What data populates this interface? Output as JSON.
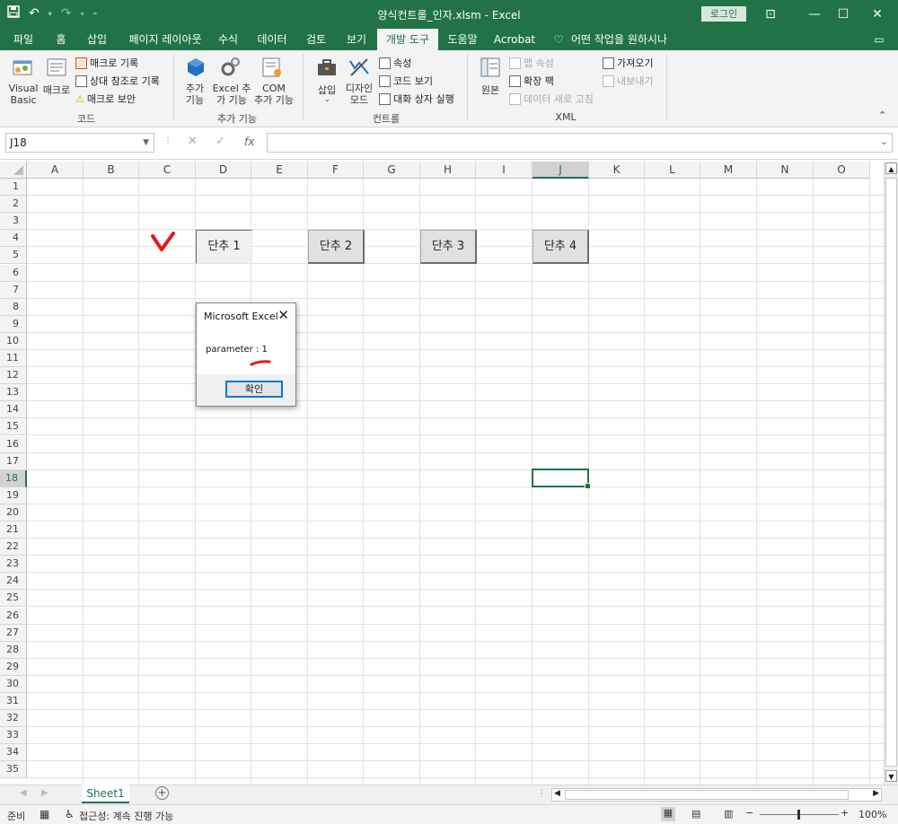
{
  "window": {
    "title": "양식컨트롤_인자.xlsm  -  Excel",
    "login_label": "로그인"
  },
  "tabs": [
    {
      "label": "파일"
    },
    {
      "label": "홈"
    },
    {
      "label": "삽입"
    },
    {
      "label": "페이지 레이아웃"
    },
    {
      "label": "수식"
    },
    {
      "label": "데이터"
    },
    {
      "label": "검토"
    },
    {
      "label": "보기"
    },
    {
      "label": "개발 도구"
    },
    {
      "label": "도움말"
    },
    {
      "label": "Acrobat"
    },
    {
      "label": "어떤 작업을 원하시나요?"
    }
  ],
  "ribbon": {
    "code": {
      "group_label": "코드",
      "visual_basic": [
        "Visual",
        "Basic"
      ],
      "macro": "매크로",
      "record_macro": "매크로 기록",
      "relative_ref": "상대 참조로 기록",
      "macro_security": "매크로 보안"
    },
    "addins": {
      "group_label": "추가 기능",
      "addins": [
        "추가",
        "기능"
      ],
      "excel_addins": [
        "Excel 추",
        "가 기능"
      ],
      "com_addins": [
        "COM",
        "추가 기능"
      ]
    },
    "controls": {
      "group_label": "컨트롤",
      "insert": "삽입",
      "design_mode": [
        "디자인",
        "모드"
      ],
      "properties": "속성",
      "view_code": "코드 보기",
      "run_dialog": "대화 상자 실행"
    },
    "xml": {
      "group_label": "XML",
      "source": "원본",
      "map_properties": "맵 속성",
      "expansion_packs": "확장 팩",
      "refresh_data": "데이터 새로 고침",
      "import": "가져오기",
      "export": "내보내기"
    }
  },
  "formula_bar": {
    "name_box": "J18",
    "fx": "fx",
    "formula": ""
  },
  "columns": [
    "A",
    "B",
    "C",
    "D",
    "E",
    "F",
    "G",
    "H",
    "I",
    "J",
    "K",
    "L",
    "M",
    "N",
    "O"
  ],
  "selected_column": "J",
  "rows": [
    "1",
    "2",
    "3",
    "4",
    "5",
    "6",
    "7",
    "8",
    "9",
    "10",
    "11",
    "12",
    "13",
    "14",
    "15",
    "16",
    "17",
    "18",
    "19",
    "20",
    "21",
    "22",
    "23",
    "24",
    "25",
    "26",
    "27",
    "28",
    "29",
    "30",
    "31",
    "32",
    "33",
    "34",
    "35"
  ],
  "selected_row": "18",
  "buttons": [
    {
      "label": "단추 1",
      "pressed": true
    },
    {
      "label": "단추 2",
      "pressed": false
    },
    {
      "label": "단추 3",
      "pressed": false
    },
    {
      "label": "단추 4",
      "pressed": false
    }
  ],
  "dialog": {
    "title": "Microsoft Excel",
    "close": "✕",
    "message": "parameter :  1",
    "ok_label": "확인"
  },
  "annotations": {
    "checkmark_color": "#e8171c",
    "underline_color": "#e8171c"
  },
  "sheets": [
    {
      "label": "Sheet1"
    }
  ],
  "status": {
    "ready": "준비",
    "accessibility": "접근성: 계속 진행 가능",
    "zoom": "100%"
  },
  "colors": {
    "brand": "#217346",
    "dialog_ok_border": "#0078d7"
  }
}
